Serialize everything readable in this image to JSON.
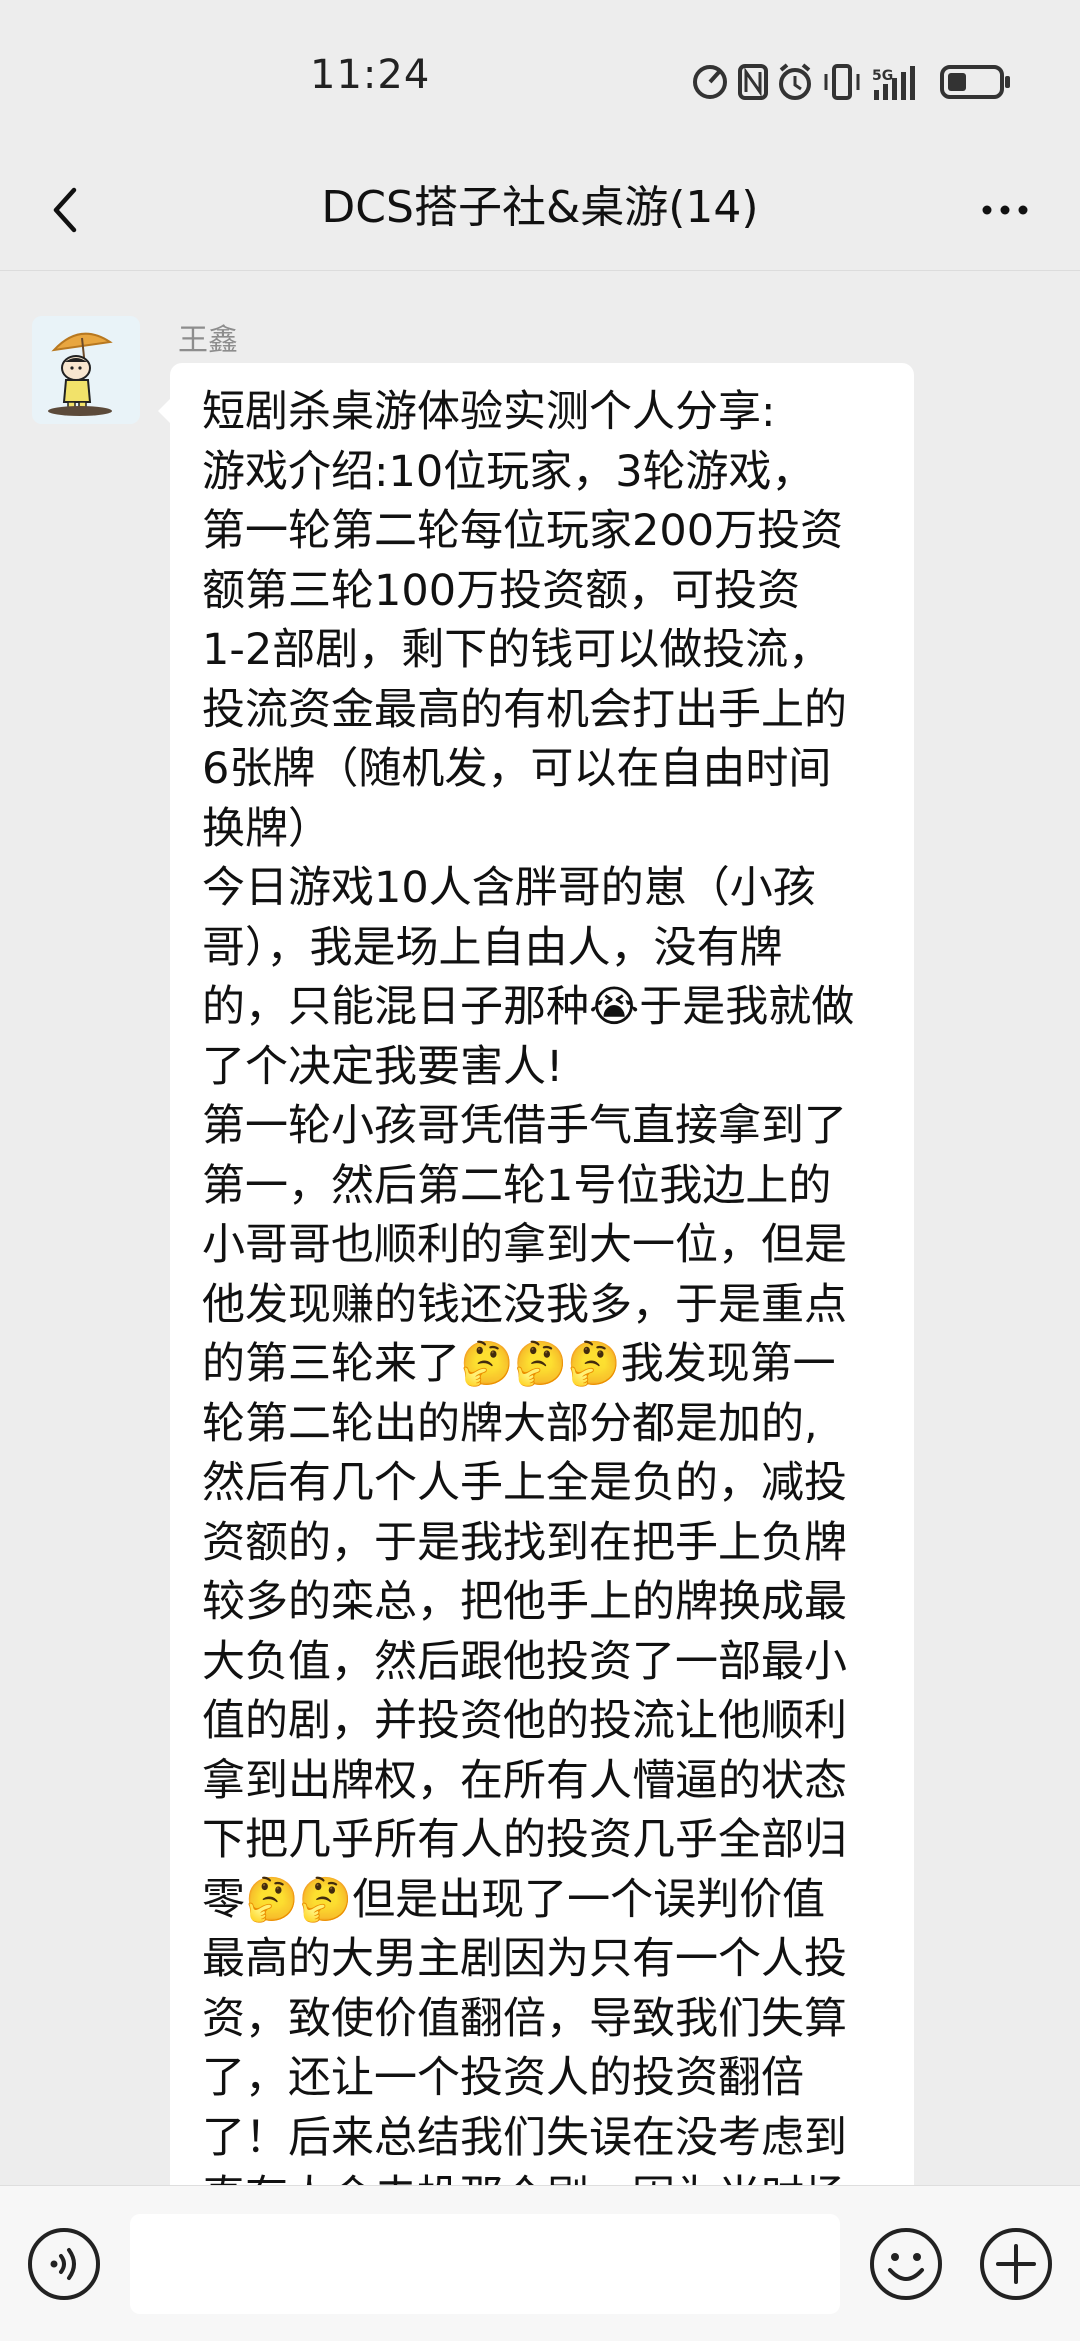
{
  "status_bar": {
    "time": "11:24",
    "icons": [
      "speed-icon",
      "nfc-icon",
      "alarm-icon",
      "vibrate-icon",
      "signal-5g-icon",
      "battery-icon"
    ],
    "network_label": "5G"
  },
  "header": {
    "back_icon": "chevron-left-icon",
    "title": "DCS搭子社&桌游(14)",
    "more_icon": "more-horizontal-icon"
  },
  "message": {
    "sender": "王鑫",
    "avatar_icon": "cartoon-avatar-umbrella",
    "lines": [
      "短剧杀桌游体验实测个人分享:",
      "游戏介绍:10位玩家，3轮游戏，",
      "第一轮第二轮每位玩家200万投资",
      "额第三轮100万投资额，可投资",
      "1-2部剧，剩下的钱可以做投流，",
      "投流资金最高的有机会打出手上的",
      "6张牌（随机发，可以在自由时间",
      "换牌）",
      "今日游戏10人含胖哥的崽（小孩",
      "哥），我是场上自由人，没有牌",
      "的，只能混日子那种😭于是我就做",
      "了个决定我要害人!",
      "第一轮小孩哥凭借手气直接拿到了",
      "第一，然后第二轮1号位我边上的",
      "小哥哥也顺利的拿到大一位，但是",
      "他发现赚的钱还没我多，于是重点",
      "的第三轮来了🤔🤔🤔我发现第一",
      "轮第二轮出的牌大部分都是加的,",
      "然后有几个人手上全是负的，减投",
      "资额的，于是我找到在把手上负牌",
      "较多的栾总，把他手上的牌换成最",
      "大负值，然后跟他投资了一部最小",
      "值的剧，并投资他的投流让他顺利",
      "拿到出牌权，在所有人懵逼的状态",
      "下把几乎所有人的投资几乎全部归",
      "零🤔🤔但是出现了一个误判价值",
      "最高的大男主剧因为只有一个人投",
      "资，致使价值翻倍，导致我们失算",
      "了，还让一个投资人的投资翻倍",
      "了！后来总结我们失误在没考虑到",
      "真有人会去投那个剧，因为当时场"
    ]
  },
  "input_bar": {
    "voice_icon": "voice-icon",
    "input_value": "",
    "emoji_icon": "emoji-icon",
    "plus_icon": "plus-circle-icon"
  },
  "colors": {
    "background": "#ededed",
    "bubble": "#ffffff",
    "name_text": "#8d8d8d",
    "input_bar": "#f7f7f7"
  }
}
